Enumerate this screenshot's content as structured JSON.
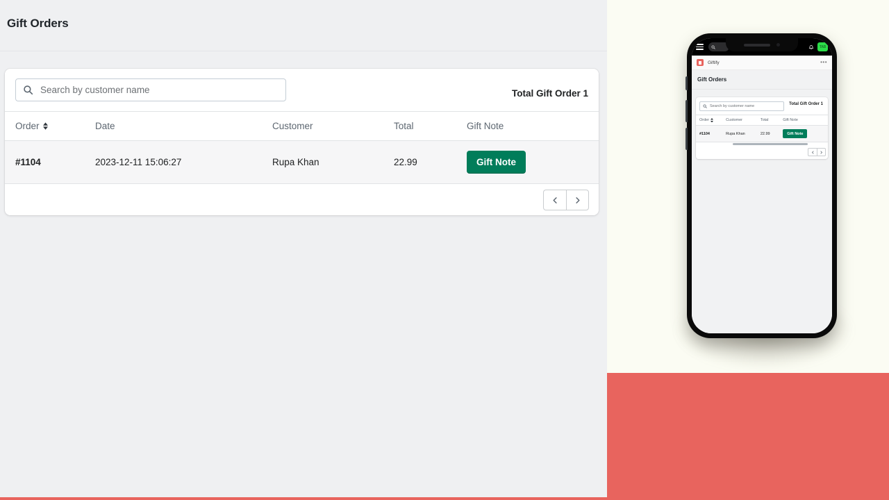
{
  "desktop": {
    "page_title": "Gift Orders",
    "search": {
      "placeholder": "Search by customer name",
      "value": "",
      "icon": "search-icon"
    },
    "total_label": "Total Gift Order 1",
    "table": {
      "columns": [
        "Order",
        "Date",
        "Customer",
        "Total",
        "Gift Note"
      ],
      "sortable_column": "Order",
      "rows": [
        {
          "order": "#1104",
          "date": "2023-12-11 15:06:27",
          "customer": "Rupa Khan",
          "total": "22.99",
          "gift_note_button": "Gift Note"
        }
      ]
    },
    "pagination": {
      "prev_icon": "chevron-left-icon",
      "next_icon": "chevron-right-icon"
    }
  },
  "phone": {
    "statusbar": {
      "menu_icon": "hamburger-menu-icon",
      "search_icon": "search-icon",
      "bell_icon": "bell-icon",
      "badge_text": "TAB"
    },
    "appbar": {
      "app_name": "Giftify",
      "logo_icon": "giftify-logo-icon",
      "more_icon": "more-horizontal-icon",
      "more_glyph": "•••"
    },
    "page_title": "Gift Orders",
    "search": {
      "placeholder": "Search by customer name",
      "icon": "search-icon"
    },
    "total_label": "Total Gift Order 1",
    "table": {
      "columns": [
        "Order",
        "Customer",
        "Total",
        "Gift Note"
      ],
      "rows": [
        {
          "order": "#1104",
          "customer": "Rupa Khan",
          "total": "22.99",
          "gift_note_button": "Gift Note"
        }
      ]
    },
    "pagination": {
      "prev_icon": "chevron-left-icon",
      "next_icon": "chevron-right-icon"
    }
  },
  "colors": {
    "accent_green": "#017d5a",
    "accent_red": "#e8645e",
    "right_background": "#fbfcf3",
    "left_background": "#eff0f2",
    "badge_green": "#2bdc48"
  }
}
